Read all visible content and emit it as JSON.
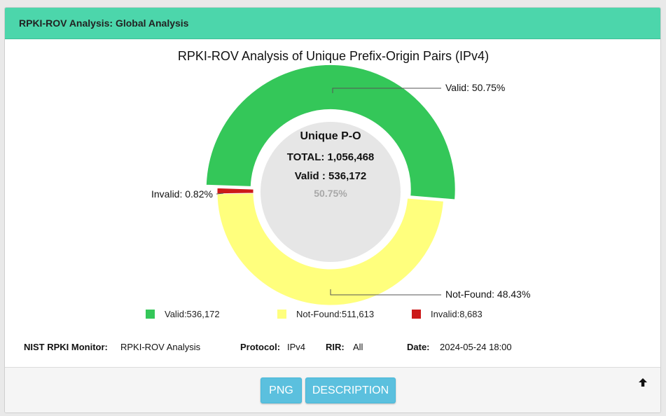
{
  "header": {
    "title": "RPKI-ROV Analysis: Global Analysis"
  },
  "chart_data": {
    "type": "pie",
    "title": "RPKI-ROV Analysis of Unique Prefix-Origin Pairs (IPv4)",
    "slices": [
      {
        "label": "Valid",
        "value": 536172,
        "percent": 50.75,
        "color": "#34c759"
      },
      {
        "label": "Not-Found",
        "value": 511613,
        "percent": 48.43,
        "color": "#ffff7d"
      },
      {
        "label": "Invalid",
        "value": 8683,
        "percent": 0.82,
        "color": "#cc1a1a"
      }
    ],
    "callouts": [
      "Valid: 50.75%",
      "Not-Found: 48.43%",
      "Invalid: 0.82%"
    ],
    "legend": [
      "Valid:536,172",
      "Not-Found:511,613",
      "Invalid:8,683"
    ],
    "legend_position": "bottom",
    "center": {
      "label": "Unique P-O",
      "total": "TOTAL: 1,056,468",
      "valid": "Valid : 536,172",
      "percent": "50.75%"
    }
  },
  "meta": {
    "monitor_label": "NIST RPKI Monitor:",
    "monitor_value": "RPKI-ROV Analysis",
    "protocol_label": "Protocol:",
    "protocol_value": "IPv4",
    "rir_label": "RIR:",
    "rir_value": "All",
    "date_label": "Date:",
    "date_value": "2024-05-24 18:00"
  },
  "footer": {
    "png_label": "PNG",
    "description_label": "DESCRIPTION",
    "icon": "arrow-up-icon"
  }
}
